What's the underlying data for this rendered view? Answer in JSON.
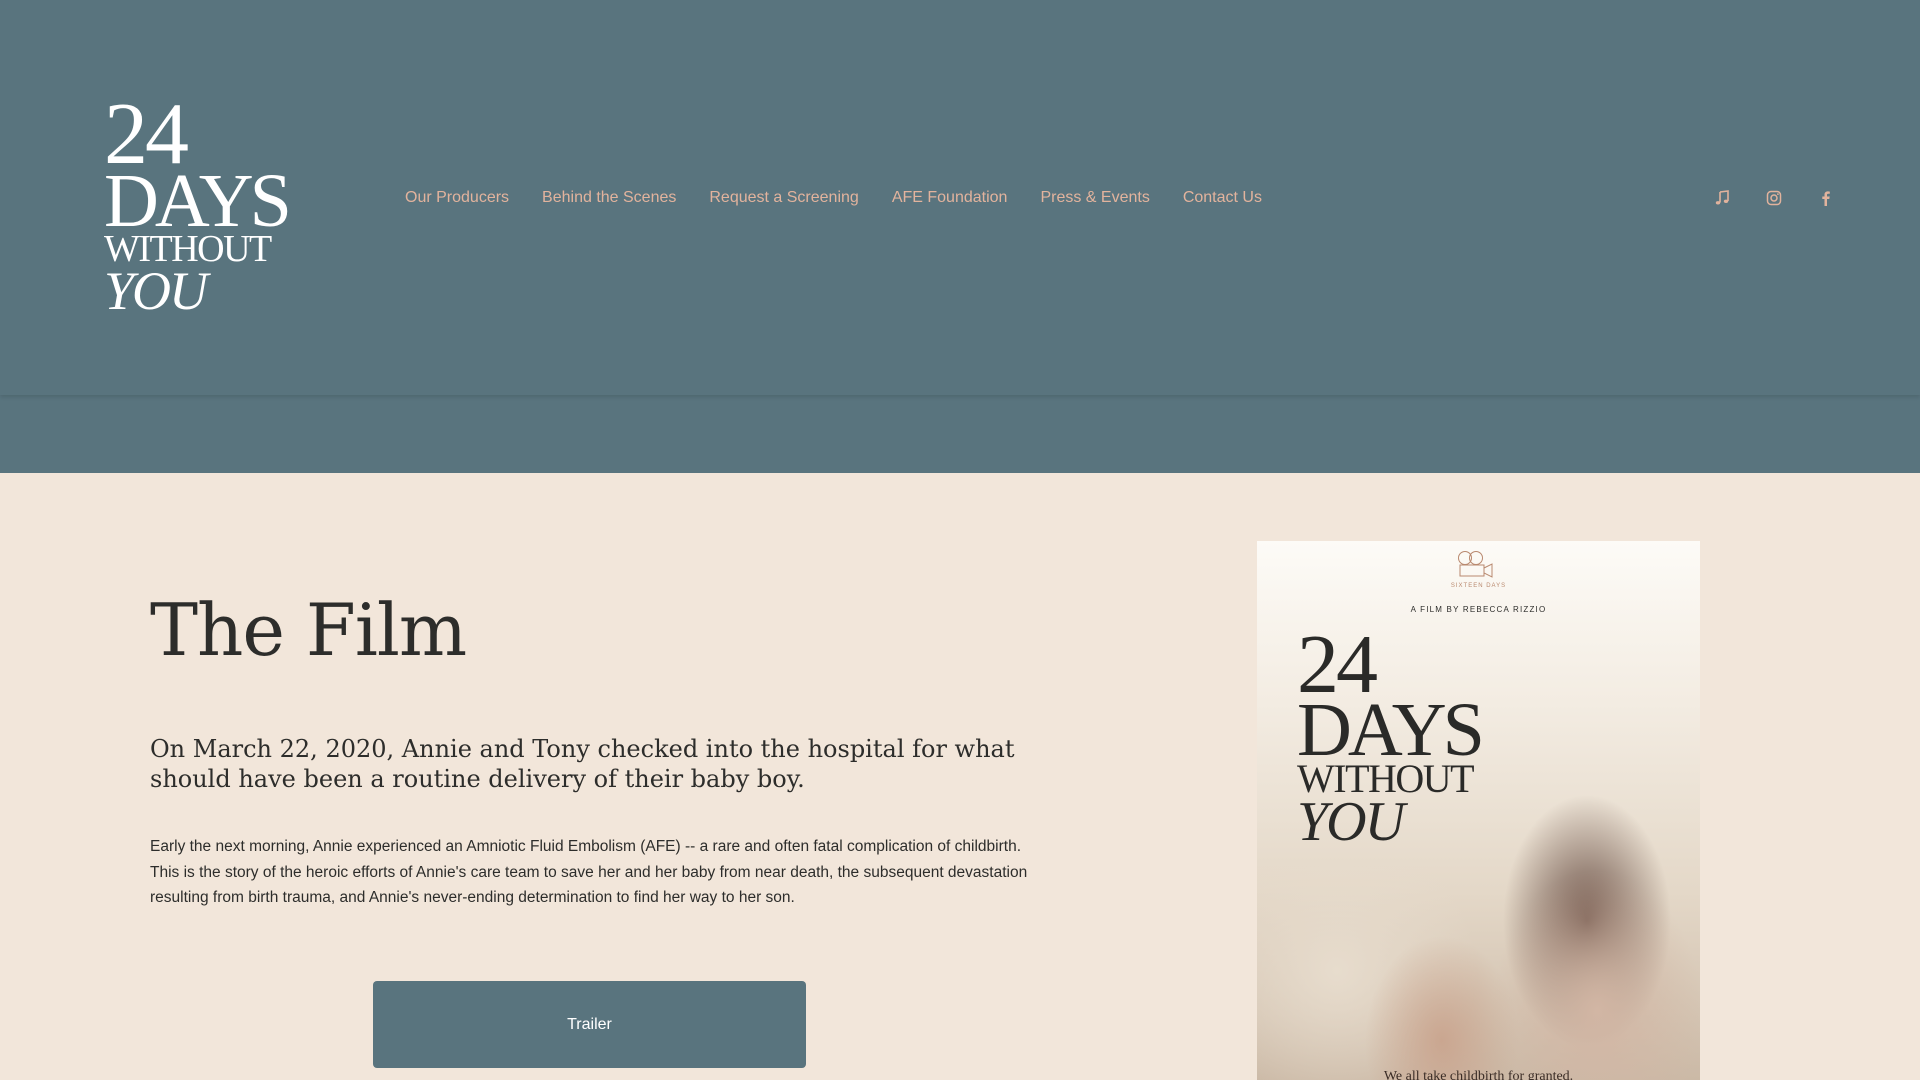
{
  "logo": {
    "line1": "24",
    "line2": "DAYS",
    "line3": "WITHOUT",
    "line4": "YOU"
  },
  "nav": {
    "items": [
      {
        "label": "Our Producers"
      },
      {
        "label": "Behind the Scenes"
      },
      {
        "label": "Request a Screening"
      },
      {
        "label": "AFE Foundation"
      },
      {
        "label": "Press & Events"
      },
      {
        "label": "Contact Us"
      }
    ]
  },
  "socials": {
    "icons": [
      "music-note-icon",
      "instagram-icon",
      "facebook-icon"
    ]
  },
  "main": {
    "title": "The Film",
    "subhead": "On March 22, 2020, Annie and Tony checked into the hospital for what should have been a routine delivery of their baby boy.",
    "body": "Early the next morning, Annie experienced an Amniotic Fluid Embolism (AFE) -- a rare and often fatal complication of childbirth. This is the story of the heroic efforts of Annie's care team to save her and her baby from near death, the subsequent devastation resulting from birth trauma, and Annie's never-ending determination to find her way to her son.",
    "trailer_label": "Trailer"
  },
  "poster": {
    "brand": "SIXTEEN DAYS",
    "byline": "A FILM BY REBECCA RIZZIO",
    "title_line1": "24",
    "title_line2": "DAYS",
    "title_line3": "WITHOUT",
    "title_line4": "YOU",
    "tagline": "We all take childbirth for granted."
  },
  "colors": {
    "header_bg": "#59747e",
    "page_bg": "#f2e6da",
    "nav_link": "#e2b39d",
    "text": "#2d2d2b",
    "button_bg": "#59747e"
  }
}
